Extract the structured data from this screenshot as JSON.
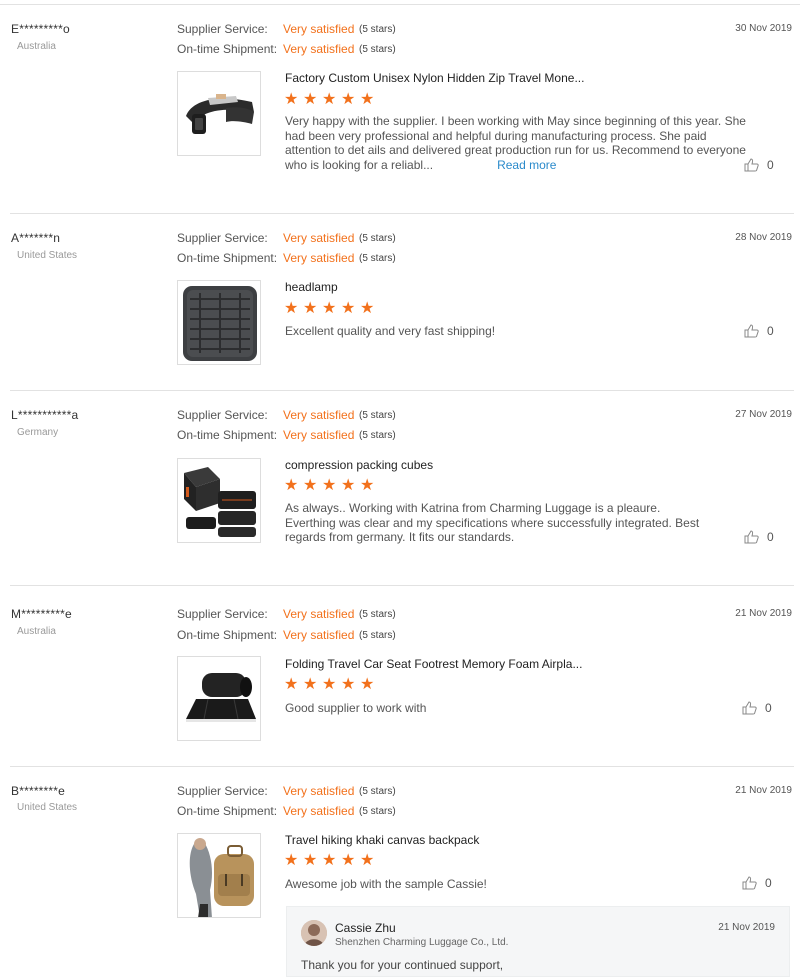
{
  "rating_labels": {
    "supplier": "Supplier Service:",
    "shipment": "On-time Shipment:"
  },
  "reviews": [
    {
      "buyer": "E*********o",
      "country": "Australia",
      "date": "30 Nov 2019",
      "supplier_rating": "Very satisfied",
      "supplier_stars": "(5 stars)",
      "shipment_rating": "Very satisfied",
      "shipment_stars": "(5 stars)",
      "product_title": "Factory Custom Unisex Nylon Hidden Zip Travel Mone...",
      "product_image": "money-belt-image",
      "stars": 5,
      "text": "Very happy with the supplier. I been working with May since beginning of this year. She had been very professional and helpful during manufacturing process. She paid attention to det ails and delivered great production run for us. Recommend to everyone who is looking for a reliabl...",
      "read_more": "Read more",
      "likes": "0"
    },
    {
      "buyer": "A*******n",
      "country": "United States",
      "date": "28 Nov 2019",
      "supplier_rating": "Very satisfied",
      "supplier_stars": "(5 stars)",
      "shipment_rating": "Very satisfied",
      "shipment_stars": "(5 stars)",
      "product_title": "headlamp",
      "product_image": "cable-organizer-image",
      "stars": 5,
      "text": "Excellent quality and very fast shipping!",
      "likes": "0"
    },
    {
      "buyer": "L***********a",
      "country": "Germany",
      "date": "27 Nov 2019",
      "supplier_rating": "Very satisfied",
      "supplier_stars": "(5 stars)",
      "shipment_rating": "Very satisfied",
      "shipment_stars": "(5 stars)",
      "product_title": "compression packing cubes",
      "product_image": "packing-cubes-image",
      "stars": 5,
      "text": "As always.. Working with Katrina from Charming Luggage is a pleaure. Everthing was clear and my specifications where successfully integrated. Best regards from germany. It fits our standards.",
      "likes": "0"
    },
    {
      "buyer": "M*********e",
      "country": "Australia",
      "date": "21 Nov 2019",
      "supplier_rating": "Very satisfied",
      "supplier_stars": "(5 stars)",
      "shipment_rating": "Very satisfied",
      "shipment_stars": "(5 stars)",
      "product_title": "Folding Travel Car Seat Footrest Memory Foam Airpla...",
      "product_image": "footrest-image",
      "stars": 5,
      "text": "Good supplier to work with",
      "likes": "0"
    },
    {
      "buyer": "B********e",
      "country": "United States",
      "date": "21 Nov 2019",
      "supplier_rating": "Very satisfied",
      "supplier_stars": "(5 stars)",
      "shipment_rating": "Very satisfied",
      "shipment_stars": "(5 stars)",
      "product_title": "Travel hiking khaki canvas backpack",
      "product_image": "backpack-image",
      "stars": 5,
      "text": "Awesome job with the sample Cassie!",
      "likes": "0"
    }
  ],
  "reply": {
    "name": "Cassie Zhu",
    "company": "Shenzhen Charming Luggage Co., Ltd.",
    "date": "21 Nov 2019",
    "text": "Thank you for your continued support,"
  },
  "colors": {
    "accent": "#f2711c",
    "link": "#2a8acb",
    "divider": "#e2e2e2"
  },
  "icons": {
    "like": "thumbs-up-icon",
    "star": "star-icon"
  }
}
